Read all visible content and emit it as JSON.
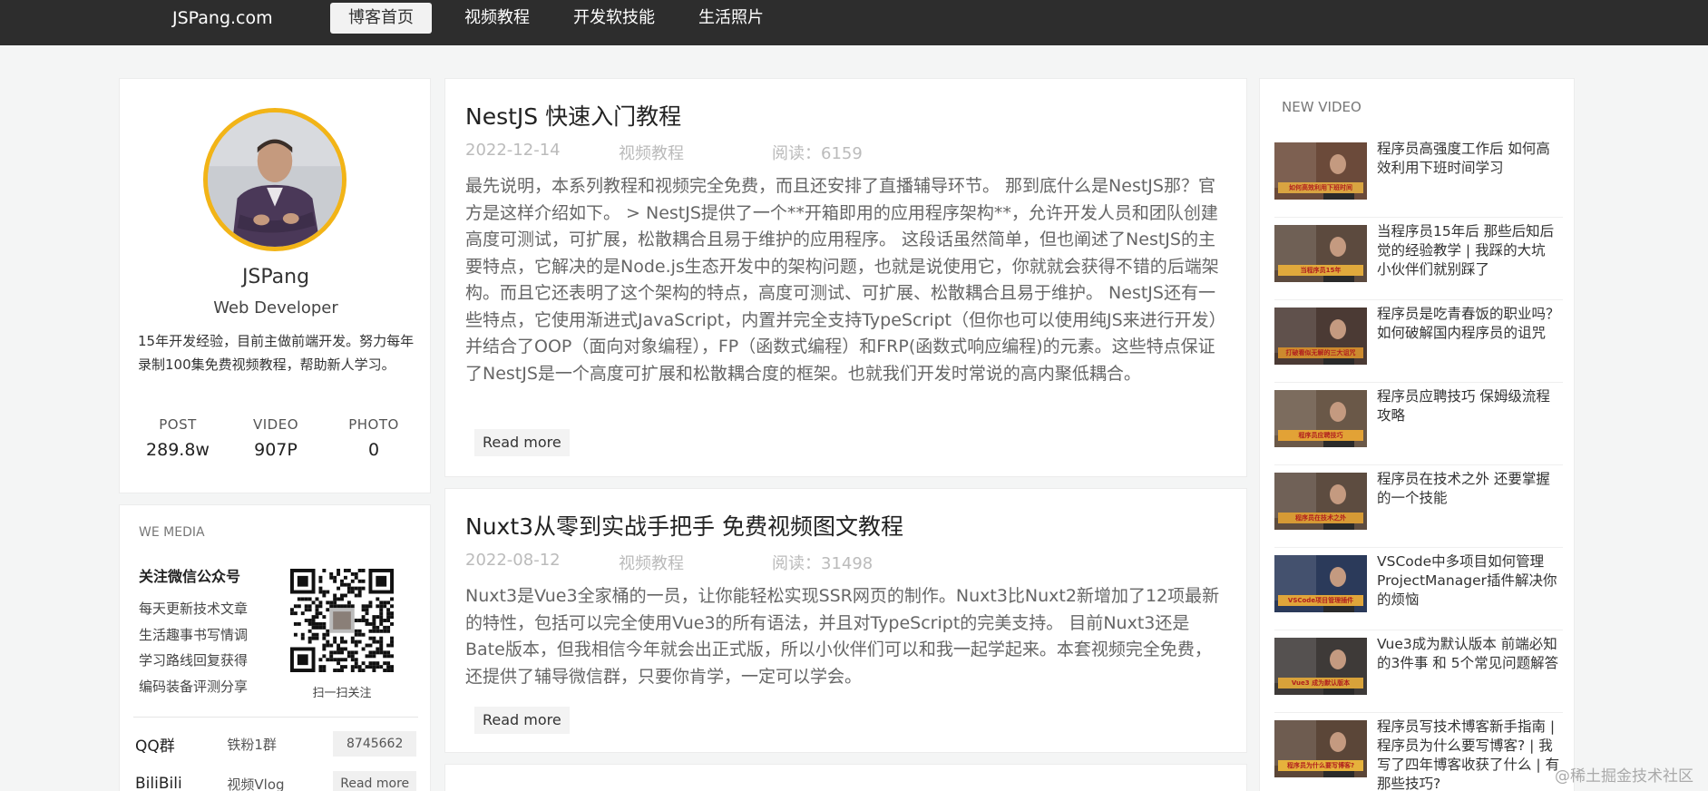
{
  "header": {
    "brand": "JSPang.com",
    "nav": [
      "博客首页",
      "视频教程",
      "开发软技能",
      "生活照片"
    ],
    "active_index": 0
  },
  "profile": {
    "name": "JSPang",
    "role": "Web Developer",
    "desc": "15年开发经验，目前主做前端开发。努力每年录制100集免费视频教程，帮助新人学习。",
    "stats": [
      {
        "label": "POST",
        "value": "289.8w"
      },
      {
        "label": "VIDEO",
        "value": "907P"
      },
      {
        "label": "PHOTO",
        "value": "0"
      }
    ]
  },
  "wemedia": {
    "title": "WE MEDIA",
    "subtitle": "关注微信公众号",
    "items": [
      "每天更新技术文章",
      "生活趣事书写情调",
      "学习路线回复获得",
      "编码装备评测分享"
    ],
    "qr_caption": "扫一扫关注",
    "rows": [
      {
        "name": "QQ群",
        "desc": "铁粉1群",
        "value": "8745662"
      },
      {
        "name": "BiliBili",
        "desc": "视频Vlog",
        "value": "Read more"
      }
    ]
  },
  "articles": [
    {
      "title": "NestJS 快速入门教程",
      "date": "2022-12-14",
      "category": "视频教程",
      "views": "阅读：6159",
      "body": "最先说明，本系列教程和视频完全免费，而且还安排了直播辅导环节。 那到底什么是NestJS那？官方是这样介绍如下。 > NestJS提供了一个**开箱即用的应用程序架构**，允许开发人员和团队创建高度可测试，可扩展，松散耦合且易于维护的应用程序。 这段话虽然简单，但也阐述了NestJS的主要特点，它解决的是Node.js生态开发中的架构问题，也就是说使用它，你就就会获得不错的后端架构。而且它还表明了这个架构的特点，高度可测试、可扩展、松散耦合且易于维护。 NestJS还有一些特点，它使用渐进式JavaScript，内置并完全支持TypeScript（但你也可以使用纯JS来进行开发）并结合了OOP（面向对象编程），FP（函数式编程）和FRP(函数式响应编程)的元素。这些特点保证了NestJS是一个高度可扩展和松散耦合度的框架。也就我们开发时常说的高内聚低耦合。",
      "read_more": "Read more"
    },
    {
      "title": "Nuxt3从零到实战手把手 免费视频图文教程",
      "date": "2022-08-12",
      "category": "视频教程",
      "views": "阅读：31498",
      "body": "Nuxt3是Vue3全家桶的一员，让你能轻松实现SSR网页的制作。Nuxt3比Nuxt2新增加了12项最新的特性，包括可以完全使用Vue3的所有语法，并且对TypeScript的完美支持。 目前Nuxt3还是Bate版本，但我相信今年就会出正式版，所以小伙伴们可以和我一起学起来。本套视频完全免费，还提供了辅导微信群，只要你肯学，一定可以学会。",
      "read_more": "Read more"
    }
  ],
  "new_video": {
    "title": "NEW VIDEO",
    "items": [
      {
        "title": "程序员高强度工作后 如何高效利用下班时间学习",
        "banner": "如何高效利用下班时间"
      },
      {
        "title": "当程序员15年后 那些后知后觉的经验教学 | 我踩的大坑 小伙伴们就别踩了",
        "banner": "当程序员15年"
      },
      {
        "title": "程序员是吃青春饭的职业吗？如何破解国内程序员的诅咒",
        "banner": "打破看似无解的三大诅咒"
      },
      {
        "title": "程序员应聘技巧 保姆级流程攻略",
        "banner": "程序员应聘技巧"
      },
      {
        "title": "程序员在技术之外 还要掌握的一个技能",
        "banner": "程序员在技术之外"
      },
      {
        "title": "VSCode中多项目如何管理 ProjectManager插件解决你的烦恼",
        "banner": "VSCode项目管理插件"
      },
      {
        "title": "Vue3成为默认版本 前端必知的3件事 和 5个常见问题解答",
        "banner": "Vue3 成为默认版本"
      },
      {
        "title": "程序员写技术博客新手指南 | 程序员为什么要写博客? | 我写了四年博客收获了什么 | 有那些技巧?",
        "banner": "程序员为什么要写博客?"
      }
    ]
  },
  "watermark": "@稀土掘金技术社区"
}
